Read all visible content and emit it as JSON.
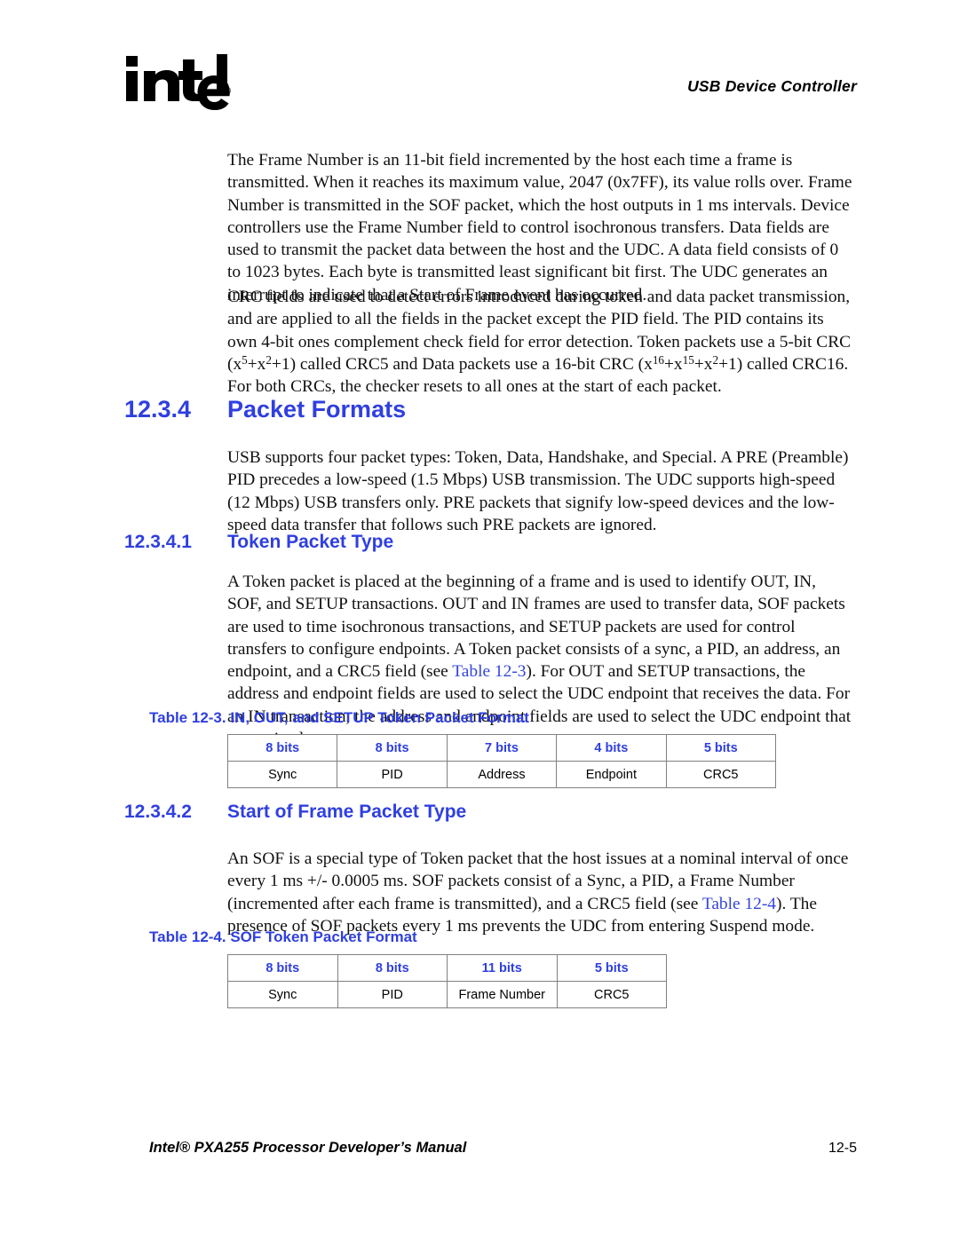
{
  "header": {
    "logo_alt": "intel",
    "logo_registered_mark": "®",
    "running_head": "USB Device Controller"
  },
  "body": {
    "para_frame_number": "The Frame Number is an 11-bit field incremented by the host each time a frame is transmitted. When it reaches its maximum value, 2047 (0x7FF), its value rolls over. Frame Number is transmitted in the SOF packet, which the host outputs in 1 ms intervals. Device controllers use the Frame Number field to control isochronous transfers. Data fields are used to transmit the packet data between the host and the UDC. A data field consists of 0 to 1023 bytes. Each byte is transmitted least significant bit first. The UDC generates an interrupt to indicate that a Start of Frame event has occurred.",
    "para_crc_part1": "CRC fields are used to detect errors introduced during token and data packet transmission, and are applied to all the fields in the packet except the PID field. The PID contains its own 4-bit ones complement check field for error detection. Token packets use a 5-bit CRC (x",
    "para_crc_sup1": "5",
    "para_crc_part2": "+x",
    "para_crc_sup2": "2",
    "para_crc_part3": "+1) called CRC5 and Data packets use a 16-bit CRC (x",
    "para_crc_sup3": "16",
    "para_crc_part4": "+x",
    "para_crc_sup4": "15",
    "para_crc_part5": "+x",
    "para_crc_sup5": "2",
    "para_crc_part6": "+1) called CRC16. For both CRCs, the checker resets to all ones at the start of each packet.",
    "para_packet_types": "USB supports four packet types: Token, Data, Handshake, and Special. A PRE (Preamble) PID precedes a low-speed (1.5 Mbps) USB transmission. The UDC supports high-speed (12 Mbps) USB transfers only. PRE packets that signify low-speed devices and the low-speed data transfer that follows such PRE packets are ignored.",
    "para_token_part1": "A Token packet is placed at the beginning of a frame and is used to identify OUT, IN, SOF, and SETUP transactions. OUT and IN frames are used to transfer data, SOF packets are used to time isochronous transactions, and SETUP packets are used for control transfers to configure endpoints. A Token packet consists of a sync, a PID, an address, an endpoint, and a CRC5 field (see ",
    "para_token_xref": "Table 12-3",
    "para_token_part2": "). For OUT and SETUP transactions, the address and endpoint fields are used to select the UDC endpoint that receives the data. For an IN transaction, the address and endpoint fields are used to select the UDC endpoint that transmits data.",
    "para_sof_part1": "An SOF is a special type of Token packet that the host issues at a nominal interval of once every 1 ms +/- 0.0005 ms. SOF packets consist of a Sync, a PID, a Frame Number (incremented after each frame is transmitted), and a CRC5 field (see ",
    "para_sof_xref": "Table 12-4",
    "para_sof_part2": "). The presence of SOF packets every 1 ms prevents the UDC from entering Suspend mode."
  },
  "headings": {
    "h_1234_num": "12.3.4",
    "h_1234_title": "Packet Formats",
    "h_12341_num": "12.3.4.1",
    "h_12341_title": "Token Packet Type",
    "h_12342_num": "12.3.4.2",
    "h_12342_title": "Start of Frame Packet Type"
  },
  "tables": [
    {
      "caption_label": "Table 12-3",
      "caption_text": ". IN, OUT, and SETUP Token Packet Format",
      "header_row": [
        "8 bits",
        "8 bits",
        "7 bits",
        "4 bits",
        "5 bits"
      ],
      "value_row": [
        "Sync",
        "PID",
        "Address",
        "Endpoint",
        "CRC5"
      ]
    },
    {
      "caption_label": "Table 12-4",
      "caption_text": ". SOF Token Packet Format",
      "header_row": [
        "8 bits",
        "8 bits",
        "11 bits",
        "5 bits"
      ],
      "value_row": [
        "Sync",
        "PID",
        "Frame Number",
        "CRC5"
      ]
    }
  ],
  "footer": {
    "manual_title": "Intel® PXA255 Processor Developer’s Manual",
    "page_number": "12-5"
  },
  "colors": {
    "heading_blue": "#2f3fe0",
    "link_blue": "#3344dd",
    "table_border": "#808080",
    "text_black": "#111111"
  }
}
